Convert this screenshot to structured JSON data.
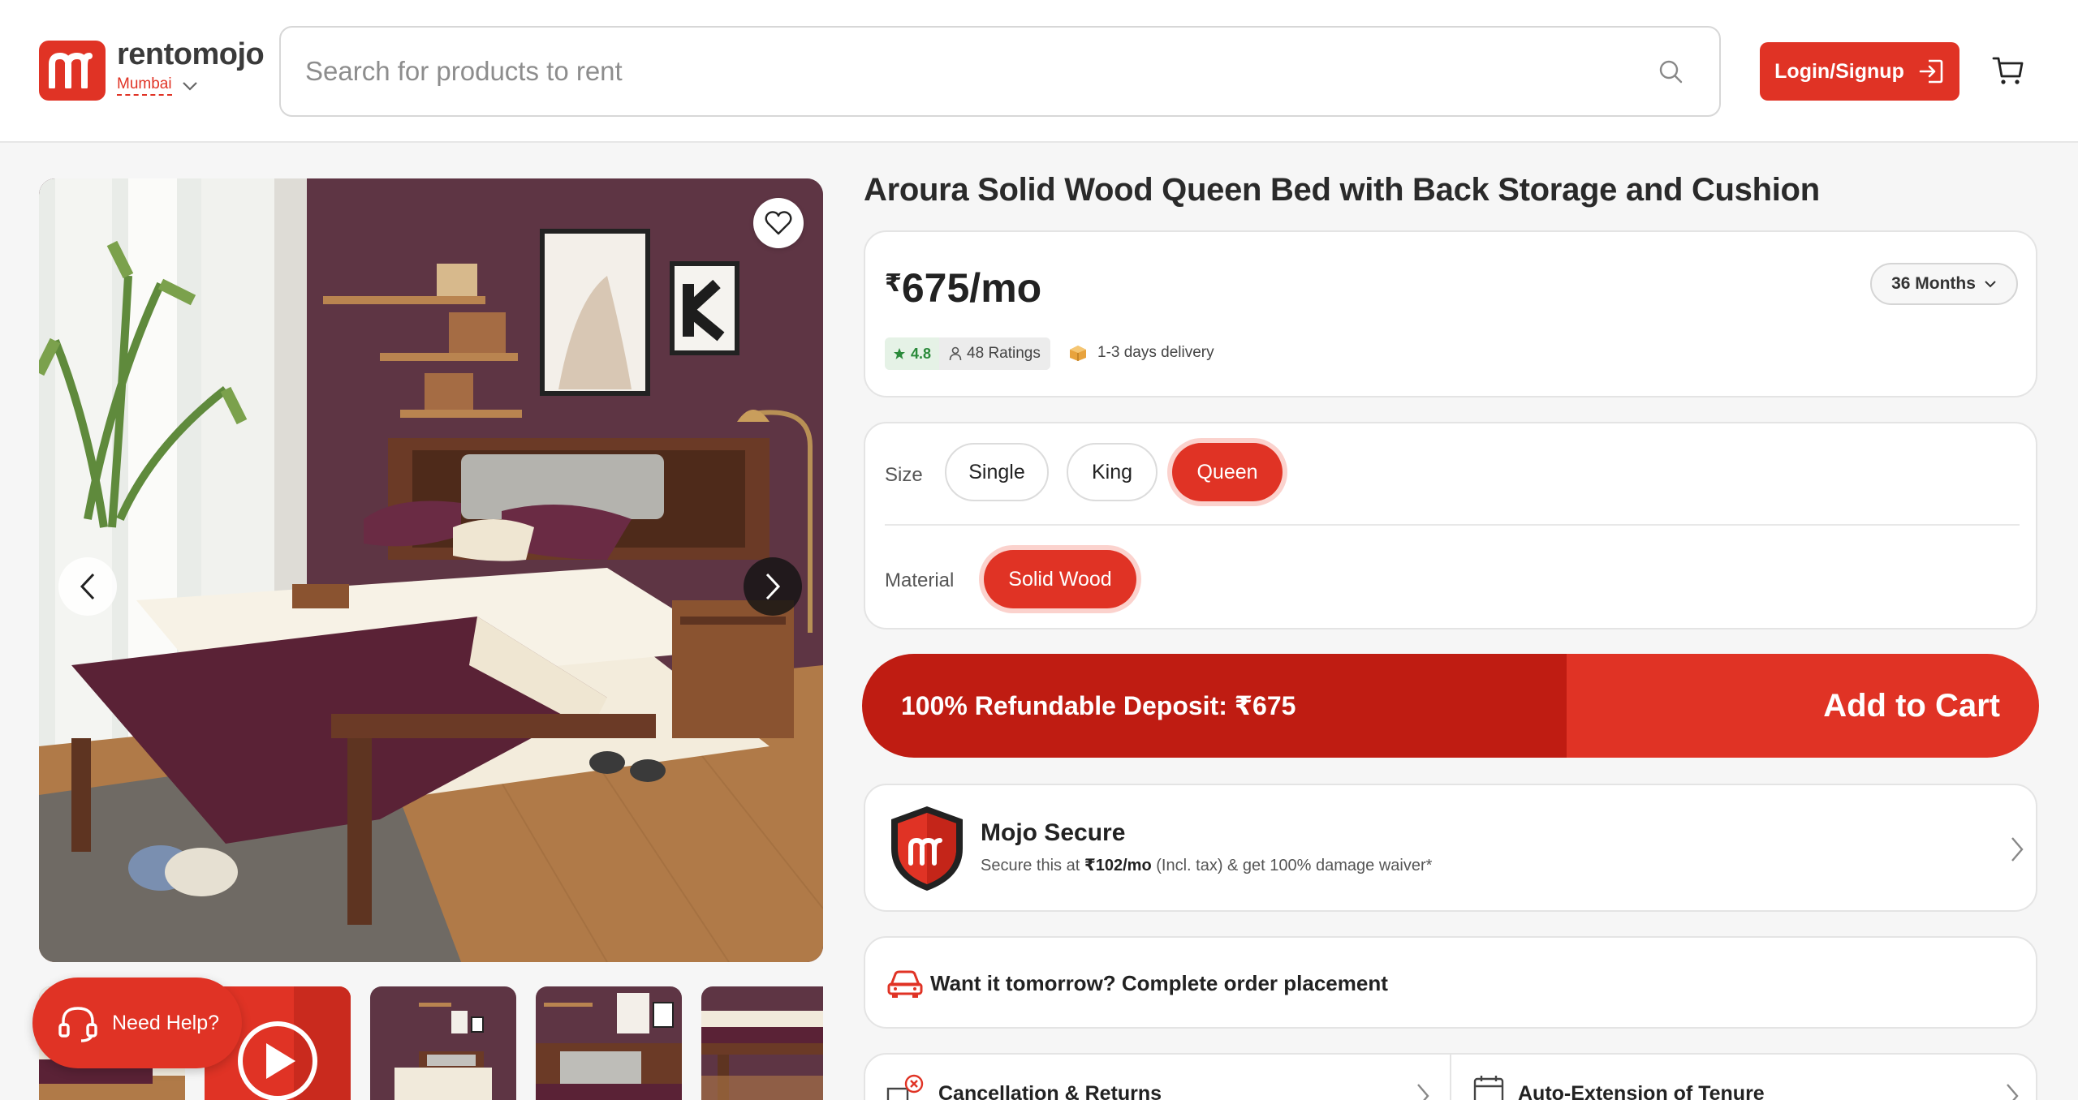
{
  "header": {
    "brand": "rentomojo",
    "city": "Mumbai",
    "search_placeholder": "Search for products to rent",
    "login_label": "Login/Signup"
  },
  "gallery": {
    "icons": [
      "heart-icon",
      "chevron-left-icon",
      "chevron-right-icon",
      "play-icon"
    ],
    "thumbnail_count": 5
  },
  "help": {
    "label": "Need Help?"
  },
  "product": {
    "title": "Aroura Solid Wood Queen Bed with Back Storage and Cushion",
    "currency": "₹",
    "price": "675/mo",
    "tenure": "36 Months",
    "rating": "4.8",
    "ratings_count": "48 Ratings",
    "delivery": "1-3 days delivery"
  },
  "options": {
    "size_label": "Size",
    "sizes": [
      "Single",
      "King",
      "Queen"
    ],
    "selected_size": "Queen",
    "material_label": "Material",
    "materials": [
      "Solid Wood"
    ],
    "selected_material": "Solid Wood"
  },
  "cta": {
    "deposit": "100% Refundable Deposit: ₹675",
    "add_to_cart": "Add to Cart"
  },
  "mojo_secure": {
    "title": "Mojo Secure",
    "sub_prefix": "Secure this at ",
    "sub_price": "₹102/mo",
    "sub_suffix": " (Incl. tax) & get 100% damage waiver*"
  },
  "tomorrow": {
    "text": "Want it tomorrow? Complete order placement"
  },
  "policies": {
    "cancellation": "Cancellation & Returns",
    "auto_extension": "Auto-Extension of Tenure"
  },
  "colors": {
    "brand_red": "#e03325",
    "deposit_red": "#bf1c12",
    "rating_green": "#2a8a3a"
  }
}
